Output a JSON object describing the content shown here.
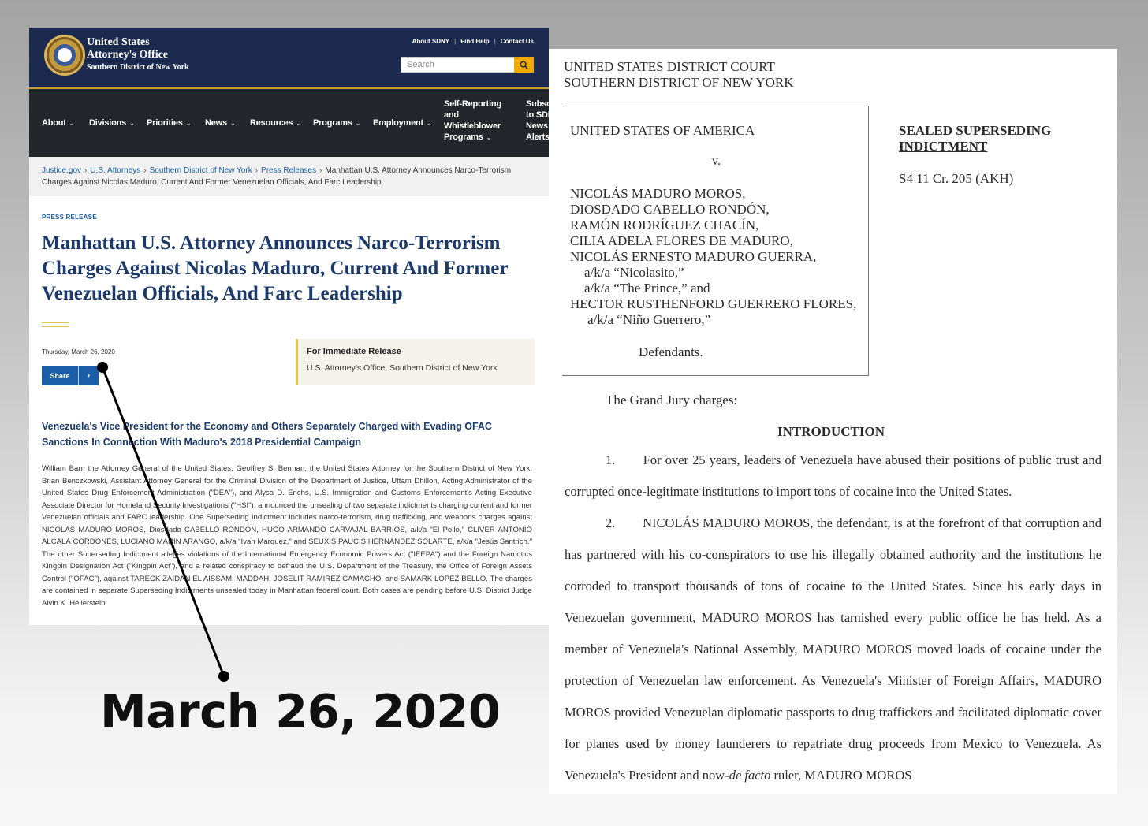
{
  "web": {
    "site_name": "United States\nAttorney's Office",
    "site_sub": "Southern District of New York",
    "top_links": [
      "About SDNY",
      "Find Help",
      "Contact Us"
    ],
    "search_placeholder": "Search",
    "nav": [
      "About",
      "Divisions",
      "Priorities",
      "News",
      "Resources",
      "Programs",
      "Employment",
      "Self-Reporting and Whistleblower Programs",
      "Subscribe to SDNY News Alerts"
    ],
    "breadcrumb": {
      "links": [
        "Justice.gov",
        "U.S. Attorneys",
        "Southern District of New York",
        "Press Releases"
      ],
      "current": "Manhattan U.S. Attorney Announces Narco-Terrorism Charges Against Nicolas Maduro, Current And Former Venezuelan Officials, And Farc Leadership"
    },
    "kicker": "PRESS RELEASE",
    "headline": "Manhattan U.S. Attorney Announces Narco-Terrorism Charges Against Nicolas Maduro, Current And Former Venezuelan Officials, And Farc Leadership",
    "date": "Thursday, March 26, 2020",
    "share_label": "Share",
    "release_title": "For Immediate Release",
    "release_office": "U.S. Attorney's Office, Southern District of New York",
    "subhead": "Venezuela's Vice President for the Economy and Others Separately Charged with Evading OFAC Sanctions In Connection With Maduro's 2018 Presidential Campaign",
    "body": "William Barr, the Attorney General of the United States, Geoffrey S. Berman, the United States Attorney for the Southern District of New York, Brian Benczkowski, Assistant Attorney General for the Criminal Division of the Department of Justice, Uttam Dhillon, Acting Administrator of the United States Drug Enforcement Administration (\"DEA\"), and Alysa D. Erichs, U.S. Immigration and Customs Enforcement's Acting Executive Associate Director for Homeland Security Investigations (\"HSI\"), announced the unsealing of two separate indictments charging current and former Venezuelan officials and FARC leadership. One Superseding Indictment includes narco-terrorism, drug trafficking, and weapons charges against NICOLÁS MADURO MOROS, Diosdado CABELLO RONDÓN, HUGO ARMANDO CARVAJAL BARRIOS, a/k/a \"El Pollo,\" CLÍVER ANTONIO ALCALÁ CORDONES, LUCIANO MARÍN ARANGO, a/k/a \"Ivan Marquez,\" and SEUXIS PAUCIS HERNÁNDEZ SOLARTE, a/k/a \"Jesús Santrich.\" The other Superseding Indictment alleges violations of the International Emergency Economic Powers Act (\"IEEPA\") and the Foreign Narcotics Kingpin Designation Act (\"Kingpin Act\"), and a related conspiracy to defraud the U.S. Department of the Treasury, the Office of Foreign Assets Control (\"OFAC\"), against TARECK ZAIDAN EL AISSAMI MADDAH, JOSELIT RAMIREZ CAMACHO, and SAMARK LOPEZ BELLO. The charges are contained in separate Superseding Indictments unsealed today in Manhattan federal court. Both cases are pending before U.S. District Judge Alvin K. Hellerstein."
  },
  "doc": {
    "court": "UNITED STATES DISTRICT COURT\nSOUTHERN DISTRICT OF NEW YORK",
    "plaintiff": "UNITED STATES OF AMERICA",
    "versus": "v.",
    "defendants": [
      "NICOLÁS MADURO MOROS,",
      "DIOSDADO CABELLO RONDÓN,",
      "RAMÓN RODRÍGUEZ CHACÍN,",
      "CILIA ADELA FLORES DE MADURO,",
      "NICOLÁS ERNESTO MADURO GUERRA,",
      "a/k/a “Nicolasito,”",
      "a/k/a “The Prince,” and",
      "HECTOR RUSTHENFORD GUERRERO FLORES,",
      "a/k/a “Niño Guerrero,”"
    ],
    "defendants_label": "Defendants.",
    "sealed_title": "SEALED SUPERSEDING\nINDICTMENT",
    "case_no": "S4 11 Cr. 205 (AKH)",
    "grand_jury": "The Grand Jury charges:",
    "intro_heading": "INTRODUCTION",
    "para1": "1.       For over 25 years, leaders of Venezuela have abused their positions of public trust and corrupted once-legitimate institutions to import tons of cocaine into the United States.",
    "para2": "2.        NICOLÁS MADURO MOROS, the defendant, is at the forefront of that corruption and has partnered with his co-conspirators to use his illegally obtained authority and the institutions he corroded to transport thousands of tons of cocaine to the United States. Since his early days in Venezuelan government, MADURO MOROS has tarnished every public office he has held. As a member of Venezuela's National Assembly, MADURO MOROS moved loads of cocaine under the protection of Venezuelan law enforcement. As Venezuela's Minister of Foreign Affairs, MADURO MOROS provided Venezuelan diplomatic passports to drug traffickers and facilitated diplomatic cover for planes used by money launderers to repatriate drug proceeds from Mexico to Venezuela. As Venezuela's President and now-",
    "para2_italic": "de facto",
    "para2_end": " ruler, MADURO MOROS"
  },
  "annotation": {
    "big_date": "March 26, 2020"
  }
}
